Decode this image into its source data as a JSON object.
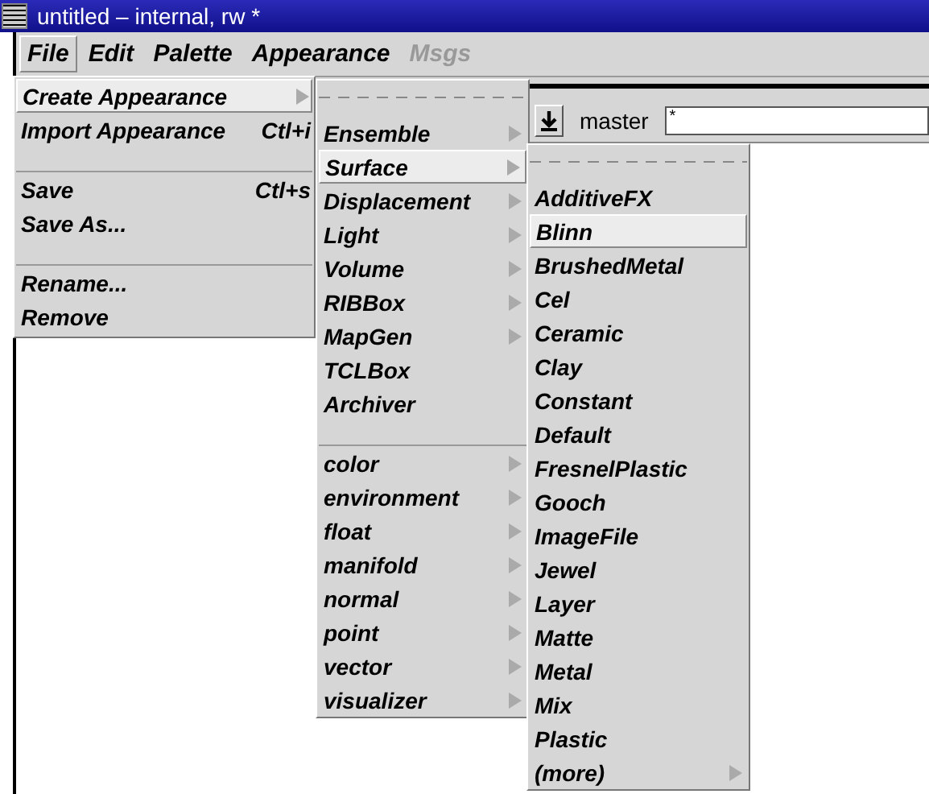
{
  "window": {
    "title": "untitled – internal, rw *"
  },
  "menubar": [
    {
      "label": "File",
      "selected": true,
      "disabled": false
    },
    {
      "label": "Edit",
      "selected": false,
      "disabled": false
    },
    {
      "label": "Palette",
      "selected": false,
      "disabled": false
    },
    {
      "label": "Appearance",
      "selected": false,
      "disabled": false
    },
    {
      "label": "Msgs",
      "selected": false,
      "disabled": true
    }
  ],
  "toolbar": {
    "label": "master",
    "field_value": "*"
  },
  "menus": [
    {
      "tearoff": false,
      "items": [
        {
          "kind": "item",
          "label": "Create Appearance",
          "submenu": true,
          "selected": true
        },
        {
          "kind": "item",
          "label": "Import Appearance",
          "shortcut": "Ctl+i",
          "submenu": false,
          "selected": false
        },
        {
          "kind": "separator"
        },
        {
          "kind": "item",
          "label": "Save",
          "shortcut": "Ctl+s",
          "submenu": false,
          "selected": false
        },
        {
          "kind": "item",
          "label": "Save As...",
          "submenu": false,
          "selected": false
        },
        {
          "kind": "separator"
        },
        {
          "kind": "item",
          "label": "Rename...",
          "submenu": false,
          "selected": false
        },
        {
          "kind": "item",
          "label": "Remove",
          "submenu": false,
          "selected": false
        }
      ]
    },
    {
      "tearoff": true,
      "items": [
        {
          "kind": "item",
          "label": "Ensemble",
          "submenu": true,
          "selected": false
        },
        {
          "kind": "item",
          "label": "Surface",
          "submenu": true,
          "selected": true
        },
        {
          "kind": "item",
          "label": "Displacement",
          "submenu": true,
          "selected": false
        },
        {
          "kind": "item",
          "label": "Light",
          "submenu": true,
          "selected": false
        },
        {
          "kind": "item",
          "label": "Volume",
          "submenu": true,
          "selected": false
        },
        {
          "kind": "item",
          "label": "RIBBox",
          "submenu": true,
          "selected": false
        },
        {
          "kind": "item",
          "label": "MapGen",
          "submenu": true,
          "selected": false
        },
        {
          "kind": "item",
          "label": "TCLBox",
          "submenu": false,
          "selected": false
        },
        {
          "kind": "item",
          "label": "Archiver",
          "submenu": false,
          "selected": false
        },
        {
          "kind": "separator"
        },
        {
          "kind": "item",
          "label": "color",
          "submenu": true,
          "selected": false
        },
        {
          "kind": "item",
          "label": "environment",
          "submenu": true,
          "selected": false
        },
        {
          "kind": "item",
          "label": "float",
          "submenu": true,
          "selected": false
        },
        {
          "kind": "item",
          "label": "manifold",
          "submenu": true,
          "selected": false
        },
        {
          "kind": "item",
          "label": "normal",
          "submenu": true,
          "selected": false
        },
        {
          "kind": "item",
          "label": "point",
          "submenu": true,
          "selected": false
        },
        {
          "kind": "item",
          "label": "vector",
          "submenu": true,
          "selected": false
        },
        {
          "kind": "item",
          "label": "visualizer",
          "submenu": true,
          "selected": false
        }
      ]
    },
    {
      "tearoff": true,
      "items": [
        {
          "kind": "item",
          "label": "AdditiveFX",
          "submenu": false,
          "selected": false
        },
        {
          "kind": "item",
          "label": "Blinn",
          "submenu": false,
          "selected": true
        },
        {
          "kind": "item",
          "label": "BrushedMetal",
          "submenu": false,
          "selected": false
        },
        {
          "kind": "item",
          "label": "Cel",
          "submenu": false,
          "selected": false
        },
        {
          "kind": "item",
          "label": "Ceramic",
          "submenu": false,
          "selected": false
        },
        {
          "kind": "item",
          "label": "Clay",
          "submenu": false,
          "selected": false
        },
        {
          "kind": "item",
          "label": "Constant",
          "submenu": false,
          "selected": false
        },
        {
          "kind": "item",
          "label": "Default",
          "submenu": false,
          "selected": false
        },
        {
          "kind": "item",
          "label": "FresnelPlastic",
          "submenu": false,
          "selected": false
        },
        {
          "kind": "item",
          "label": "Gooch",
          "submenu": false,
          "selected": false
        },
        {
          "kind": "item",
          "label": "ImageFile",
          "submenu": false,
          "selected": false
        },
        {
          "kind": "item",
          "label": "Jewel",
          "submenu": false,
          "selected": false
        },
        {
          "kind": "item",
          "label": "Layer",
          "submenu": false,
          "selected": false
        },
        {
          "kind": "item",
          "label": "Matte",
          "submenu": false,
          "selected": false
        },
        {
          "kind": "item",
          "label": "Metal",
          "submenu": false,
          "selected": false
        },
        {
          "kind": "item",
          "label": "Mix",
          "submenu": false,
          "selected": false
        },
        {
          "kind": "item",
          "label": "Plastic",
          "submenu": false,
          "selected": false
        },
        {
          "kind": "item",
          "label": "(more)",
          "submenu": true,
          "selected": false
        }
      ]
    }
  ]
}
